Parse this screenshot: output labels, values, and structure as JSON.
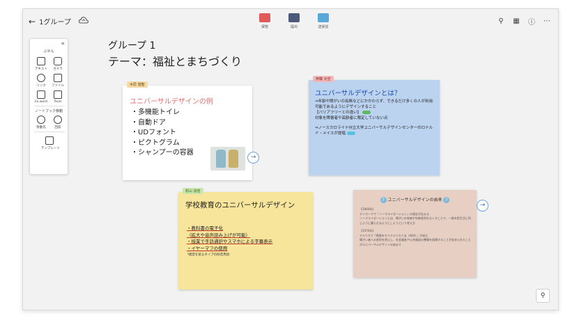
{
  "topbar": {
    "back_label": "1グループ",
    "center_tools": [
      {
        "label": "保管",
        "icon": "folder-icon",
        "color": "#e05a5a"
      },
      {
        "label": "提出",
        "icon": "inbox-icon",
        "color": "#4a5a78"
      },
      {
        "label": "送受信",
        "icon": "share-icon",
        "color": "#5aa8d8"
      }
    ],
    "right_tools": [
      "search-icon",
      "screen-icon",
      "help-icon",
      "more-icon"
    ]
  },
  "palette": {
    "section1": "ふせん",
    "items1": [
      {
        "label": "テキスト",
        "icon": "text-icon"
      },
      {
        "label": "カメラ",
        "icon": "camera-icon"
      },
      {
        "label": "リンク",
        "icon": "link-icon"
      },
      {
        "label": "ファイル",
        "icon": "file-icon"
      },
      {
        "label": "Ex.word",
        "icon": "word-icon"
      },
      {
        "label": "Tools",
        "icon": "cube-icon"
      }
    ],
    "section2": "ノートブック移動",
    "items2": [
      {
        "label": "移動先",
        "icon": "move-icon"
      },
      {
        "label": "回収",
        "icon": "collect-icon"
      }
    ],
    "template_label": "テンプレート"
  },
  "heading": {
    "group": "グループ 1",
    "theme": "テーマ：福祉とまちづくり"
  },
  "card1": {
    "tag": "木原 悠聖",
    "title": "ユニバーサルデザインの例",
    "items": [
      "・多機能トイレ",
      "・自動ドア",
      "・UDフォント",
      "・ピクトグラム",
      "・シャンプーの容器"
    ]
  },
  "card2": {
    "tag": "伊藤 大空",
    "title": "ユニバーサルデザインとは？",
    "line1": "⇒年齢や障がいの有無などにかかわらず、できるだけ多くの人が利用可能であるようにデザインすること",
    "line2": "【バリアフリーとの違い】",
    "line3": "対象を障害者や高齢者に限定していない点",
    "line4": "⇒ノースカロライナ州立大学ユニバーサルデザインセンターのロナルド・メイスが提唱"
  },
  "card3": {
    "tag": "松山 詩音",
    "title": "学校教育のユニバーサルデザイン",
    "line1": "・教科書の電子化",
    "line2": "（拡大や音声読み上げが可能）",
    "line3": "・授業で手話通訳やスマホによる字幕表示",
    "line4": "・イヤーマフの使用",
    "note": "└雑音を遮るタイプの防音用具"
  },
  "card4": {
    "title": "ユニバーサルデザインの由来",
    "line1": "【1960年】",
    "line2": "デンマークで「ノーマライゼーション」の理念が広まる",
    "line3": "ノーマライゼーションとは、障がいの有無や年齢差別をなくすことで、一般市民生活と同じように暮らせるようにしようという考え方",
    "line4": "【1970年】",
    "line5": "アメリカで「障害をもつアメリカ人法（ADA）」が成立",
    "line6": "障がい者への差別を禁止し、社会福祉や公共施設の整備を保障することが定められたことがユニバーサルデザインの始まり"
  }
}
